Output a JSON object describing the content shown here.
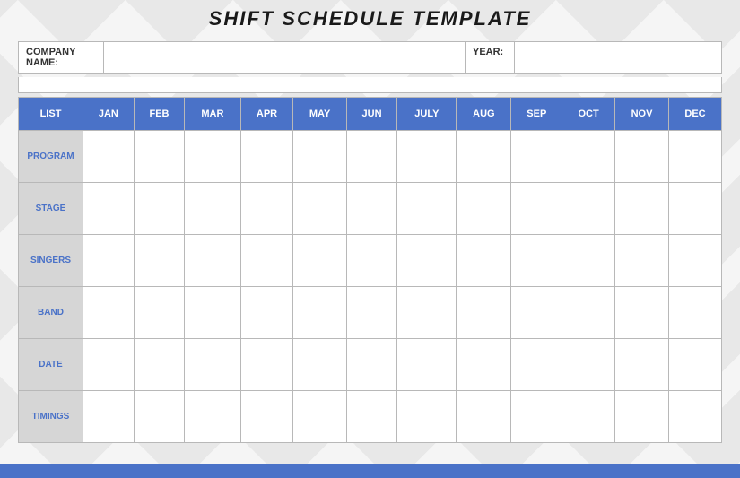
{
  "title": "SHIFT SCHEDULE TEMPLATE",
  "info": {
    "company_label": "COMPANY NAME:",
    "company_value": "",
    "year_label": "YEAR:",
    "year_value": ""
  },
  "headers": {
    "list": "LIST",
    "months": [
      "JAN",
      "FEB",
      "MAR",
      "APR",
      "MAY",
      "JUN",
      "JULY",
      "AUG",
      "SEP",
      "OCT",
      "NOV",
      "DEC"
    ]
  },
  "rows": [
    {
      "label": "PROGRAM",
      "cells": [
        "",
        "",
        "",
        "",
        "",
        "",
        "",
        "",
        "",
        "",
        "",
        ""
      ]
    },
    {
      "label": "STAGE",
      "cells": [
        "",
        "",
        "",
        "",
        "",
        "",
        "",
        "",
        "",
        "",
        "",
        ""
      ]
    },
    {
      "label": "SINGERS",
      "cells": [
        "",
        "",
        "",
        "",
        "",
        "",
        "",
        "",
        "",
        "",
        "",
        ""
      ]
    },
    {
      "label": "BAND",
      "cells": [
        "",
        "",
        "",
        "",
        "",
        "",
        "",
        "",
        "",
        "",
        "",
        ""
      ]
    },
    {
      "label": "DATE",
      "cells": [
        "",
        "",
        "",
        "",
        "",
        "",
        "",
        "",
        "",
        "",
        "",
        ""
      ]
    },
    {
      "label": "TIMINGS",
      "cells": [
        "",
        "",
        "",
        "",
        "",
        "",
        "",
        "",
        "",
        "",
        "",
        ""
      ]
    }
  ]
}
